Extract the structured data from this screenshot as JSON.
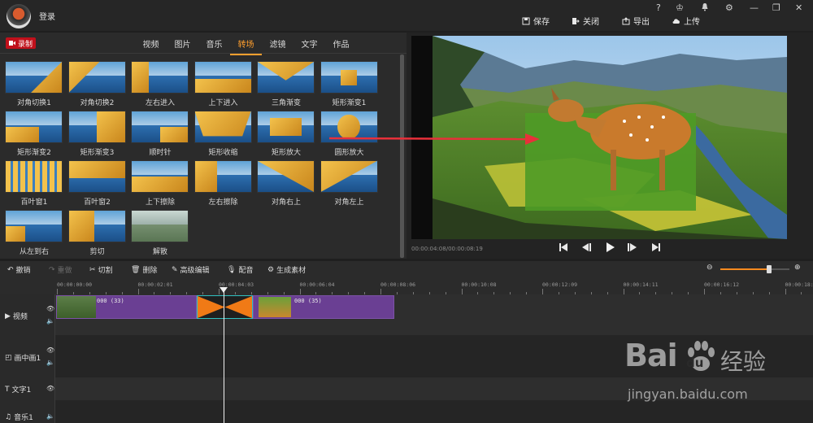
{
  "titlebar": {
    "login": "登录",
    "help": "?",
    "vip": "♔",
    "bell": "🔔",
    "settings": "⚙",
    "minimize": "—",
    "restore": "❐",
    "close": "✕"
  },
  "actions": {
    "save": "保存",
    "close": "关闭",
    "export": "导出",
    "upload": "上传"
  },
  "left": {
    "record": "录制",
    "tabs": [
      "视频",
      "图片",
      "音乐",
      "转场",
      "滤镜",
      "文字",
      "作品"
    ],
    "active_tab": "转场",
    "transitions": [
      "对角切换1",
      "对角切换2",
      "左右进入",
      "上下进入",
      "三角渐变",
      "矩形渐变1",
      "矩形渐变2",
      "矩形渐变3",
      "顺时针",
      "矩形收缩",
      "矩形放大",
      "圆形放大",
      "百叶窗1",
      "百叶窗2",
      "上下擦除",
      "左右擦除",
      "对角右上",
      "对角左上",
      "从左到右",
      "剪切",
      "解散"
    ]
  },
  "preview": {
    "timecode": "00:00:04:08/00:00:08:19"
  },
  "toolbar": {
    "undo": "撤销",
    "redo": "重做",
    "cut": "切割",
    "delete": "删除",
    "advanced": "高级编辑",
    "dub": "配音",
    "generate": "生成素材"
  },
  "ruler": [
    "00:00:00:00",
    "00:00:02:01",
    "00:00:04:03",
    "00:00:06:04",
    "00:00:08:06",
    "00:00:10:08",
    "00:00:12:09",
    "00:00:14:11",
    "00:00:16:12",
    "00:00:18:"
  ],
  "tracks": {
    "video": "视频",
    "pip": "画中画1",
    "text": "文字1",
    "music": "音乐1"
  },
  "clips": {
    "clip1": "000 (33)",
    "clip2": "000 (35)"
  },
  "zoom": {
    "level": 0.7
  },
  "watermark": {
    "brand": "Bai",
    "du": "du",
    "cn": "经验",
    "url": "jingyan.baidu.com"
  }
}
